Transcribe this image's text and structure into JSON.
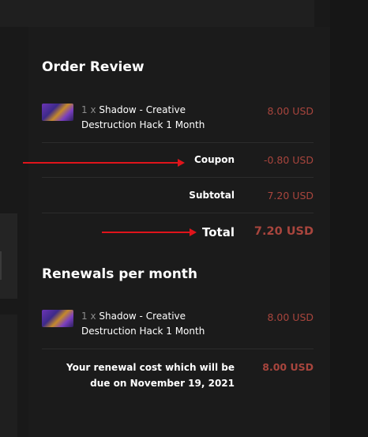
{
  "order_review": {
    "title": "Order Review",
    "item": {
      "quantity": "1 x",
      "name": "Shadow - Creative Destruction Hack 1 Month",
      "price": "8.00 USD"
    },
    "coupon": {
      "label": "Coupon",
      "value": "-0.80 USD"
    },
    "subtotal": {
      "label": "Subtotal",
      "value": "7.20 USD"
    },
    "total": {
      "label": "Total",
      "value": "7.20 USD"
    }
  },
  "renewals": {
    "title": "Renewals per month",
    "item": {
      "quantity": "1 x",
      "name": "Shadow - Creative Destruction Hack 1 Month",
      "price": "8.00 USD"
    },
    "renewal_cost": {
      "label": "Your renewal cost which will be due on November 19, 2021",
      "value": "8.00 USD"
    }
  },
  "colors": {
    "background": "#191919",
    "price_accent": "#a8453d",
    "annotation_arrow": "#e0141b"
  }
}
